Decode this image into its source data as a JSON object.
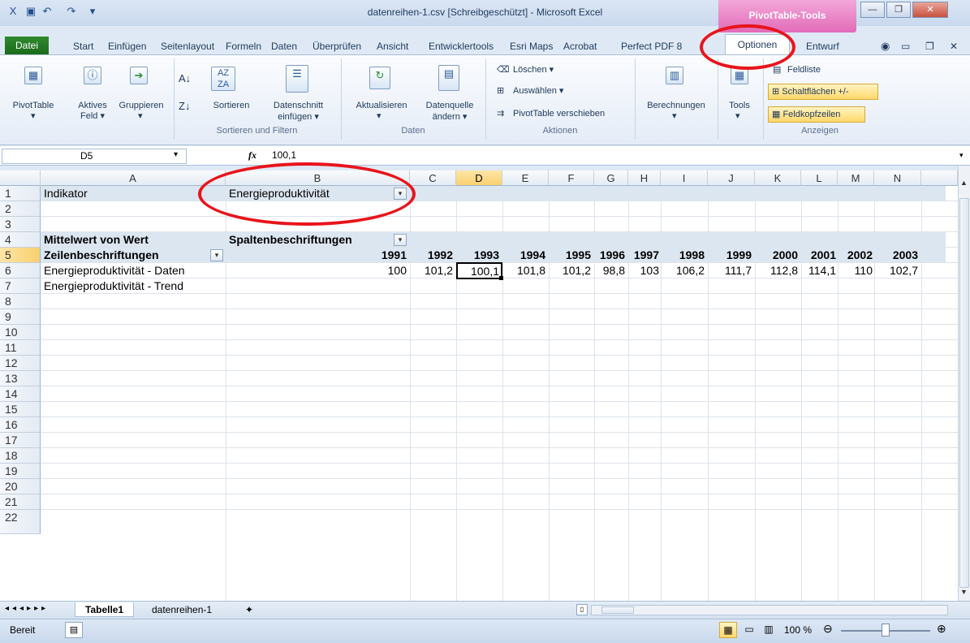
{
  "window": {
    "title": "datenreihen-1.csv  [Schreibgeschützt]  -  Microsoft Excel",
    "context_tab_group": "PivotTable-Tools"
  },
  "tabs": [
    "Datei",
    "Start",
    "Einfügen",
    "Seitenlayout",
    "Formeln",
    "Daten",
    "Überprüfen",
    "Ansicht",
    "Entwicklertools",
    "Esri Maps",
    "Acrobat",
    "Perfect PDF 8",
    "Optionen",
    "Entwurf"
  ],
  "ribbon": {
    "pivottable": "PivotTable",
    "aktives_feld": [
      "Aktives",
      "Feld ▾"
    ],
    "gruppieren": "Gruppieren",
    "sortieren": "Sortieren",
    "datenschnitt": [
      "Datenschnitt",
      "einfügen ▾"
    ],
    "group_sort": "Sortieren und Filtern",
    "aktualisieren": "Aktualisieren",
    "datenquelle": [
      "Datenquelle",
      "ändern ▾"
    ],
    "group_daten": "Daten",
    "loeschen": "Löschen ▾",
    "auswaehlen": "Auswählen ▾",
    "verschieben": "PivotTable verschieben",
    "group_aktionen": "Aktionen",
    "berechnungen": "Berechnungen",
    "tools": "Tools",
    "feldliste": "Feldliste",
    "schaltflaechen": "Schaltflächen +/-",
    "feldkopfzeilen": "Feldkopfzeilen",
    "group_anzeigen": "Anzeigen"
  },
  "formula_bar": {
    "name_box": "D5",
    "fx": "fx",
    "value": "100,1"
  },
  "columns": [
    "A",
    "B",
    "C",
    "D",
    "E",
    "F",
    "G",
    "H",
    "I",
    "J",
    "K",
    "L",
    "M",
    "N"
  ],
  "rows": [
    "1",
    "2",
    "3",
    "4",
    "5",
    "6",
    "7",
    "8",
    "9",
    "10",
    "11",
    "12",
    "13",
    "14",
    "15",
    "16",
    "17",
    "18",
    "19",
    "20",
    "21",
    "22"
  ],
  "pivot": {
    "filter_label": "Indikator",
    "filter_value": "Energieproduktivität",
    "value_label": "Mittelwert von Wert",
    "col_label": "Spaltenbeschriftungen",
    "row_label": "Zeilenbeschriftungen",
    "years": [
      "1991",
      "1992",
      "1993",
      "1994",
      "1995",
      "1996",
      "1997",
      "1998",
      "1999",
      "2000",
      "2001",
      "2002",
      "2003"
    ],
    "row1_label": "Energieproduktivität - Daten",
    "row1_values": [
      "100",
      "101,2",
      "100,1",
      "101,8",
      "101,2",
      "98,8",
      "103",
      "106,2",
      "111,7",
      "112,8",
      "114,1",
      "110",
      "102,7"
    ],
    "row2_label": "Energieproduktivität - Trend"
  },
  "sheets": [
    "Tabelle1",
    "datenreihen-1"
  ],
  "status": {
    "ready": "Bereit",
    "zoom": "100 %"
  },
  "colors": {
    "accent": "#1a6a1a",
    "pivot_band": "#dce6f1",
    "annotation": "#e8141b"
  }
}
